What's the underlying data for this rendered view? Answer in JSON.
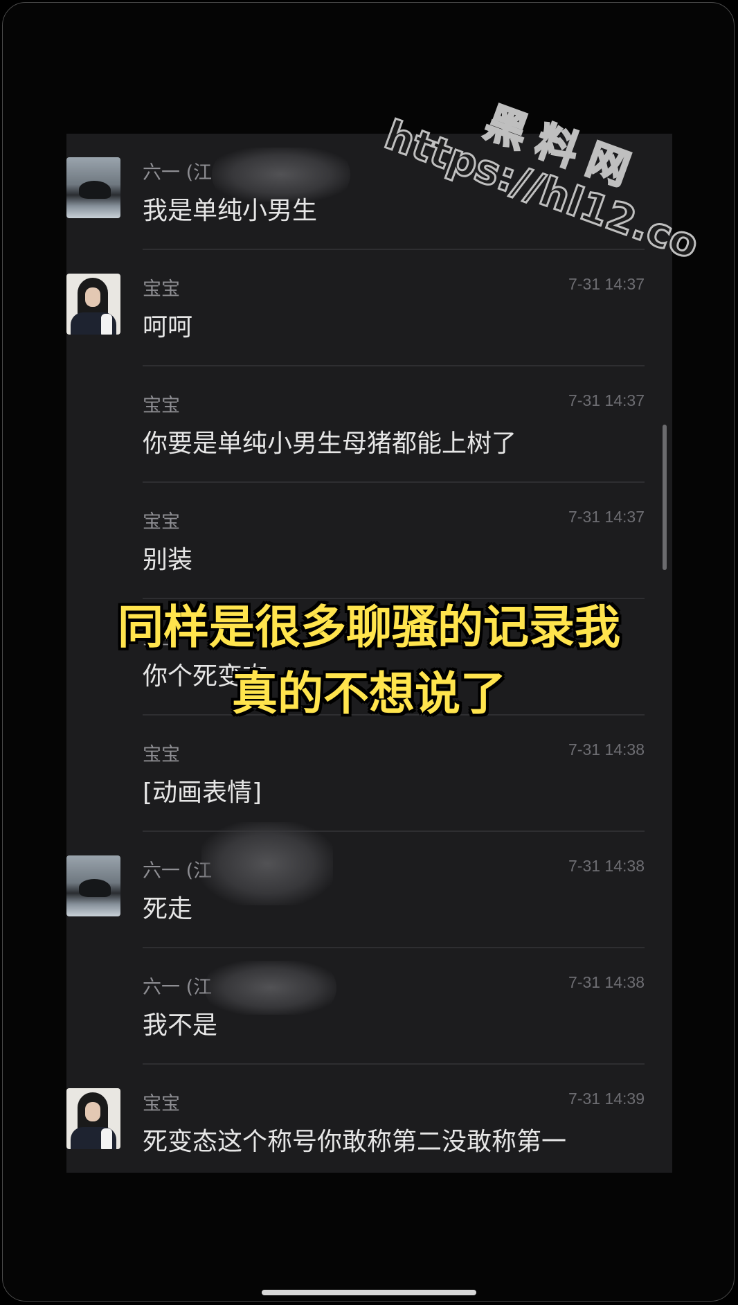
{
  "watermark": {
    "line1": "黑料网",
    "line2": "https://hl12.co"
  },
  "caption": {
    "line1": "同样是很多聊骚的记录我",
    "line2": "真的不想说了"
  },
  "messages": [
    {
      "sender": "六一 (江",
      "time": "",
      "text": "我是单纯小男生",
      "avatar": "rock-avatar"
    },
    {
      "sender": "宝宝",
      "time": "7-31 14:37",
      "text": "呵呵",
      "avatar": "girl-avatar"
    },
    {
      "sender": "宝宝",
      "time": "7-31 14:37",
      "text": "你要是单纯小男生母猪都能上树了",
      "avatar": ""
    },
    {
      "sender": "宝宝",
      "time": "7-31 14:37",
      "text": "别装",
      "avatar": ""
    },
    {
      "sender": "宝宝",
      "time": "",
      "text": "你个死变态",
      "avatar": ""
    },
    {
      "sender": "宝宝",
      "time": "7-31 14:38",
      "text": "[动画表情]",
      "avatar": ""
    },
    {
      "sender": "六一 (江",
      "time": "7-31 14:38",
      "text": "死走",
      "avatar": "rock-avatar"
    },
    {
      "sender": "六一 (江",
      "time": "7-31 14:38",
      "text": "我不是",
      "avatar": ""
    },
    {
      "sender": "宝宝",
      "time": "7-31 14:39",
      "text": "死变态这个称号你敢称第二没敢称第一",
      "avatar": "girl-avatar"
    }
  ]
}
